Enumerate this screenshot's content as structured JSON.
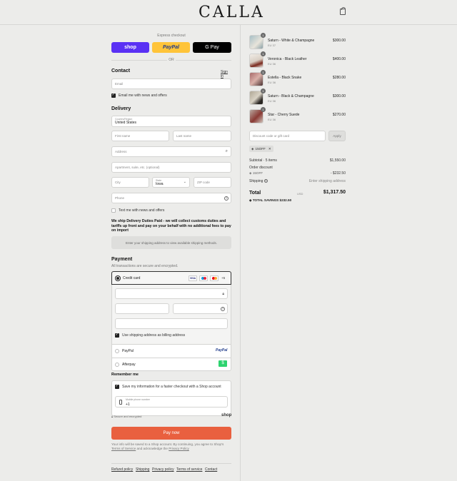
{
  "header": {
    "logo": "CALLA",
    "cart_icon": "shopping-bag-icon"
  },
  "express": {
    "title": "Express checkout",
    "shop_label": "shop",
    "paypal_label": "PayPal",
    "gpay_label": "G Pay",
    "or_label": "OR"
  },
  "contact": {
    "heading": "Contact",
    "sign_in": "Sign in",
    "email_placeholder": "Email",
    "news_label": "Email me with news and offers"
  },
  "delivery": {
    "heading": "Delivery",
    "country_label": "Country/Region",
    "country_value": "United States",
    "first_name": "First name",
    "last_name": "Last name",
    "address": "Address",
    "apartment": "Apartment, suite, etc. (optional)",
    "city": "City",
    "state_label": "State",
    "state_value": "Iowa",
    "zip": "ZIP code",
    "phone": "Phone",
    "text_news": "Text me with news and offers",
    "duties_note": "We ship Delivery Duties Paid - we will collect customs duties and tariffs up front and pay on your behalf with no additional fees to pay on import",
    "shipping_note": "Enter your shipping address to view available shipping methods."
  },
  "payment": {
    "heading": "Payment",
    "secure_note": "All transactions are secure and encrypted.",
    "credit_card": "Credit card",
    "card_more": "+5",
    "card_visa": "VISA",
    "billing_label": "Use shipping address as billing address",
    "paypal": "PayPal",
    "paypal_logo": "PayPal",
    "afterpay": "Afterpay"
  },
  "remember": {
    "heading": "Remember me",
    "save_label": "Save my information for a faster checkout with a Shop account",
    "mobile_label": "Mobile phone number",
    "mobile_value": "+1",
    "secure_label": "Secure and encrypted",
    "shop_label": "shop"
  },
  "pay_button": "Pay now",
  "legal_1": "Your info will be saved to a Shop account. By continuing, you agree to Shop's",
  "legal_tos": "Terms of Service",
  "legal_mid": "and acknowledge the",
  "legal_privacy": "Privacy Policy",
  "footer": {
    "links": [
      "Refund policy",
      "Shipping",
      "Privacy policy",
      "Terms of service",
      "Contact"
    ]
  },
  "order": {
    "items": [
      {
        "name": "Saturn - White & Champagne",
        "size": "EU 37",
        "price": "$300.00",
        "qty": "1"
      },
      {
        "name": "Veronica - Black Leather",
        "size": "EU 36",
        "price": "$400.00",
        "qty": "1"
      },
      {
        "name": "Estella - Black Snake",
        "size": "EU 36",
        "price": "$280.00",
        "qty": "1"
      },
      {
        "name": "Saturn - Black & Champagne",
        "size": "EU 36",
        "price": "$300.00",
        "qty": "1"
      },
      {
        "name": "Star - Cherry Suede",
        "size": "EU 36",
        "price": "$270.00",
        "qty": "1"
      }
    ],
    "discount_placeholder": "Discount code or gift card",
    "apply": "Apply",
    "tag": "15OFF",
    "subtotal_label": "Subtotal · 5 items",
    "subtotal_value": "$1,550.00",
    "order_discount": "Order discount",
    "discount_code": "15OFF",
    "discount_value": "- $232.50",
    "shipping_label": "Shipping",
    "shipping_value": "Enter shipping address",
    "total_label": "Total",
    "currency": "USD",
    "total_value": "$1,317.50",
    "savings_label": "TOTAL SAVINGS",
    "savings_value": "$232.50"
  },
  "colors": {
    "shop": "#5a31f4",
    "paypal": "#ffc439",
    "pay_now": "#e9603f"
  }
}
